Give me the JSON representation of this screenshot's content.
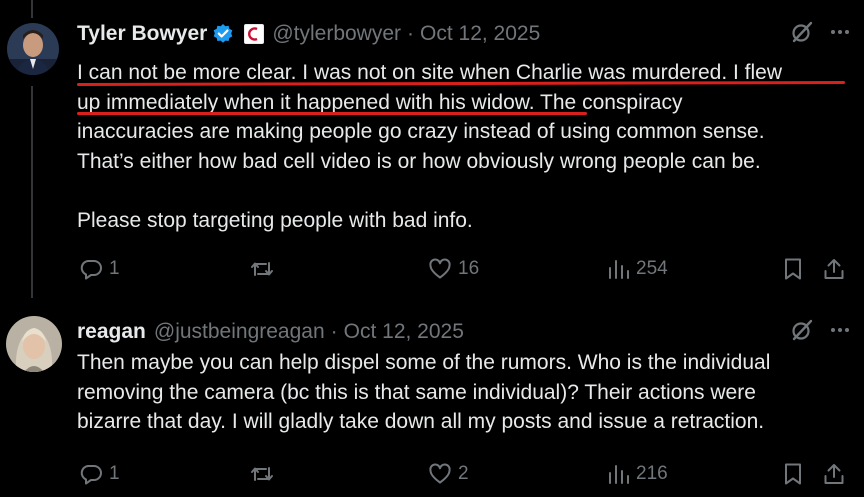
{
  "posts": [
    {
      "author_name": "Tyler Bowyer",
      "handle": "@tylerbowyer",
      "separator": "·",
      "date": "Oct 12, 2025",
      "body_lines": [
        "I can not be more clear. I was not on site when Charlie was murdered. I flew",
        "up immediately when it happened with his widow. The conspiracy",
        "inaccuracies are making people go crazy instead of using common sense.",
        "That’s either how bad cell video is or how obviously wrong people can be.",
        "",
        "Please stop targeting people with bad info."
      ],
      "replies": "1",
      "reposts": "",
      "likes": "16",
      "views": "254"
    },
    {
      "author_name": "reagan",
      "handle": "@justbeingreagan",
      "separator": "·",
      "date": "Oct 12, 2025",
      "body_lines": [
        "Then maybe you can help dispel some of the rumors. Who is the individual",
        "removing the camera (bc this is that same individual)? Their actions were",
        "bizarre that day. I will gladly take down all my posts and issue a retraction."
      ],
      "replies": "1",
      "reposts": "",
      "likes": "2",
      "views": "216"
    }
  ],
  "icons": {
    "more": "more-icon",
    "grok": "grok-icon"
  },
  "colors": {
    "background": "#000000",
    "text": "#e7e9ea",
    "muted": "#71767b",
    "verified": "#1d9bf0",
    "annotation": "#d9201c"
  }
}
